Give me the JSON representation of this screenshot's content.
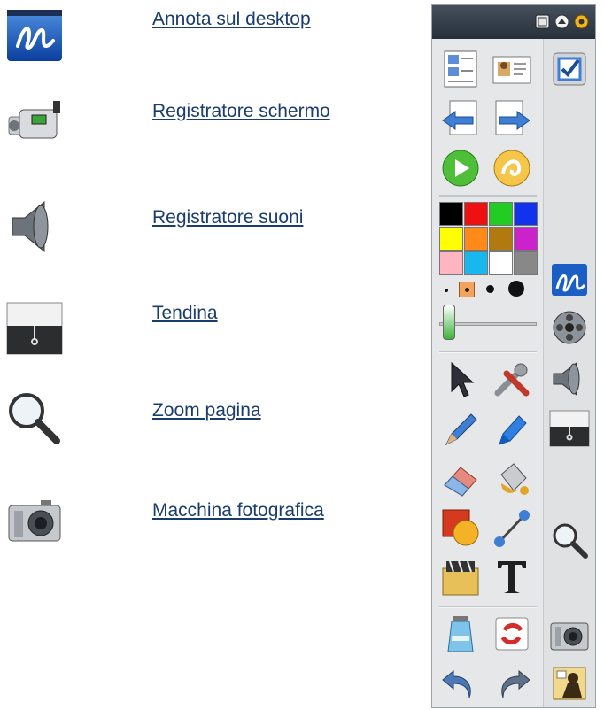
{
  "tools": [
    {
      "id": "annota",
      "label": "Annota sul desktop",
      "icon": "pen-annotate-icon"
    },
    {
      "id": "schermo",
      "label": "Registratore schermo",
      "icon": "video-camera-icon"
    },
    {
      "id": "suoni",
      "label": "Registratore suoni",
      "icon": "speaker-icon"
    },
    {
      "id": "tendina",
      "label": "Tendina",
      "icon": "screen-shade-icon"
    },
    {
      "id": "zoom",
      "label": "Zoom pagina",
      "icon": "magnifier-icon"
    },
    {
      "id": "foto",
      "label": "Macchina fotografica",
      "icon": "camera-icon"
    }
  ],
  "palette": {
    "header_buttons": [
      "window-icon",
      "up-arrow-icon",
      "settings-icon"
    ],
    "colors": [
      "#000000",
      "#ee1111",
      "#22cc22",
      "#1133ee",
      "#ffff00",
      "#ff8a1a",
      "#b07a10",
      "#cc22cc",
      "#ffb6c1",
      "#18b8ee",
      "#ffffff",
      "#888888"
    ],
    "left_tools": [
      "page-list-icon",
      "profile-card-icon",
      "previous-page-icon",
      "next-page-icon",
      "play-icon",
      "gesture-icon",
      "select-arrow-icon",
      "tools-icon",
      "pen-icon",
      "highlighter-icon",
      "eraser-icon",
      "fill-bucket-icon",
      "shapes-icon",
      "line-icon",
      "gallery-icon",
      "text-icon",
      "clear-icon",
      "refresh-icon",
      "undo-icon",
      "redo-icon"
    ],
    "right_tools": [
      "checkbox-icon",
      "pen-annotate-icon",
      "film-reel-icon",
      "speaker-icon",
      "screen-shade-icon",
      "magnifier-icon",
      "camera-icon",
      "help-icon"
    ]
  }
}
